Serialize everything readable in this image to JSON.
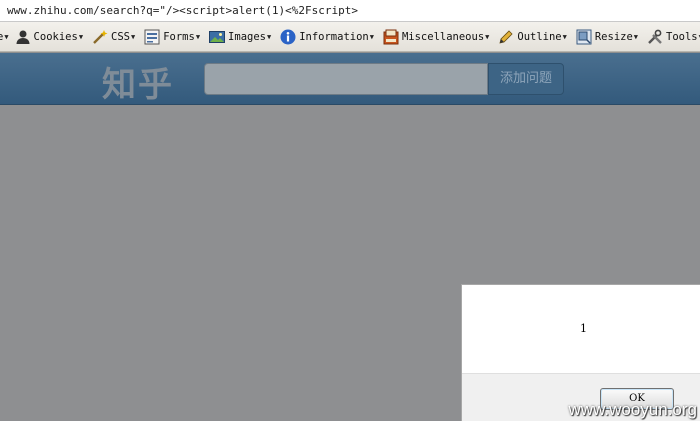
{
  "address_bar": {
    "url": "www.zhihu.com/search?q=\"/><script>alert(1)<%2Fscript>"
  },
  "toolbar": {
    "items": [
      {
        "label": "e",
        "icon": "caret-icon"
      },
      {
        "label": "Cookies",
        "icon": "user-icon"
      },
      {
        "label": "CSS",
        "icon": "wand-icon"
      },
      {
        "label": "Forms",
        "icon": "form-icon"
      },
      {
        "label": "Images",
        "icon": "image-icon"
      },
      {
        "label": "Information",
        "icon": "info-icon"
      },
      {
        "label": "Miscellaneous",
        "icon": "misc-icon"
      },
      {
        "label": "Outline",
        "icon": "pencil-icon"
      },
      {
        "label": "Resize",
        "icon": "resize-icon"
      },
      {
        "label": "Tools",
        "icon": "tools-icon"
      }
    ]
  },
  "header": {
    "logo": "知乎",
    "ask_button": "添加问题",
    "search_value": ""
  },
  "alert": {
    "message": "1",
    "ok_label": "OK"
  },
  "watermark": "www.wooyun.org",
  "colors": {
    "header": "#3d6485",
    "overlay": "#8e8f91",
    "dialog_bg": "#ffffff",
    "dialog_footer": "#f0f0f0"
  }
}
